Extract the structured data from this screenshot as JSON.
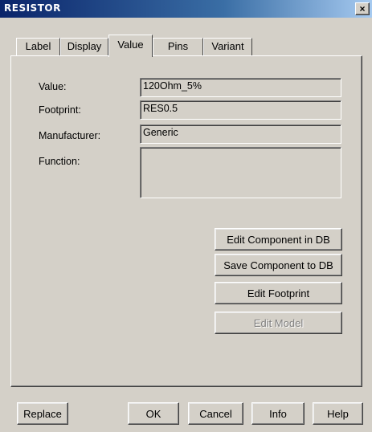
{
  "window": {
    "title": "RESISTOR",
    "close_glyph": "×"
  },
  "tabs": [
    {
      "label": "Label"
    },
    {
      "label": "Display"
    },
    {
      "label": "Value",
      "active": true
    },
    {
      "label": "Pins"
    },
    {
      "label": "Variant"
    }
  ],
  "fields": {
    "value_label": "Value:",
    "value": "120Ohm_5%",
    "footprint_label": "Footprint:",
    "footprint": "RES0.5",
    "manufacturer_label": "Manufacturer:",
    "manufacturer": "Generic",
    "function_label": "Function:",
    "function": ""
  },
  "actions": {
    "edit_component": "Edit Component in DB",
    "save_component": "Save Component to DB",
    "edit_footprint": "Edit Footprint",
    "edit_model": "Edit Model"
  },
  "footer": {
    "replace": "Replace",
    "ok": "OK",
    "cancel": "Cancel",
    "info": "Info",
    "help": "Help"
  }
}
